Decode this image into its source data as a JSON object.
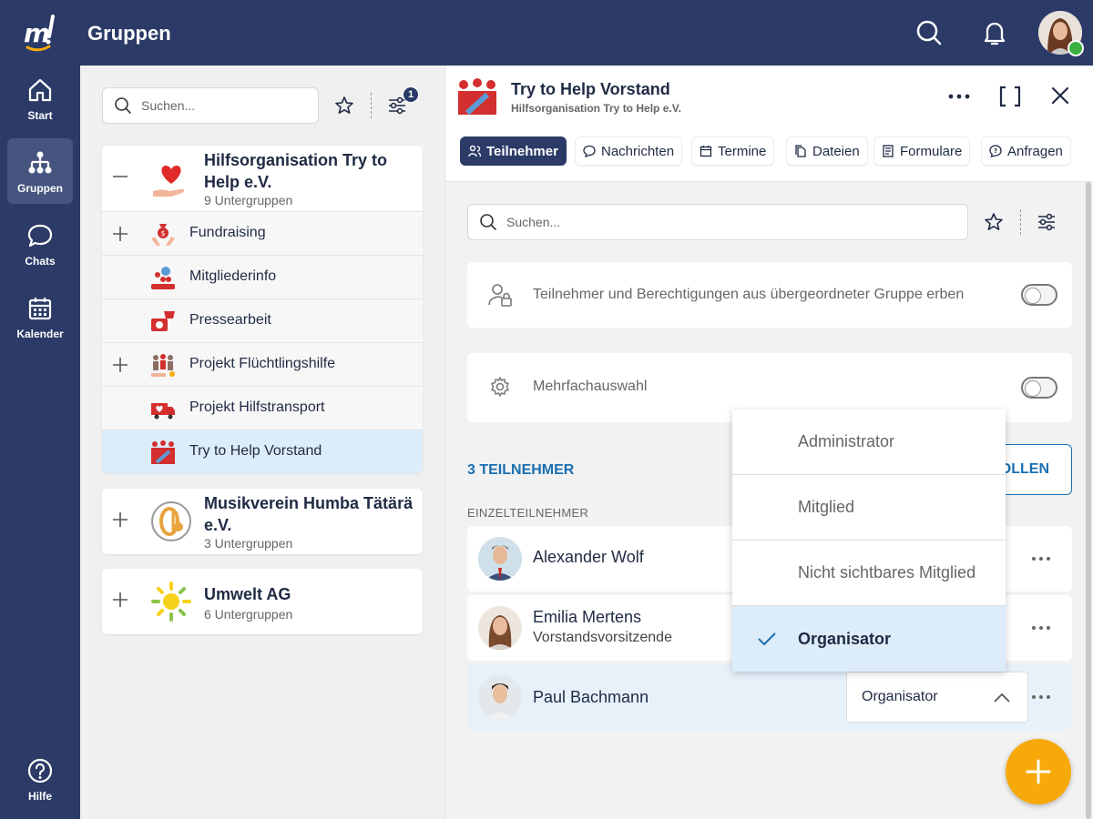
{
  "app": {
    "title": "Gruppen"
  },
  "topbar": {
    "icons": [
      "search-icon",
      "bell-icon",
      "avatar"
    ]
  },
  "sidebar": {
    "items": [
      {
        "label": "Start",
        "icon": "home-icon"
      },
      {
        "label": "Gruppen",
        "icon": "hierarchy-icon",
        "active": true
      },
      {
        "label": "Chats",
        "icon": "chat-bubble-icon"
      },
      {
        "label": "Kalender",
        "icon": "calendar-icon"
      },
      {
        "label": "Hilfe",
        "icon": "help-icon"
      }
    ]
  },
  "groups": {
    "search_placeholder": "Suchen...",
    "filter_badge": "1",
    "cards": [
      {
        "title": "Hilfsorganisation Try to Help e.V.",
        "subtitle": "9 Untergruppen",
        "expanded": true,
        "subgroups": [
          {
            "label": "Fundraising",
            "has_children": true
          },
          {
            "label": "Mitgliederinfo",
            "has_children": false
          },
          {
            "label": "Pressearbeit",
            "has_children": false
          },
          {
            "label": "Projekt Flüchtlingshilfe",
            "has_children": true
          },
          {
            "label": "Projekt Hilfstransport",
            "has_children": false
          },
          {
            "label": "Try to Help Vorstand",
            "has_children": false,
            "selected": true
          }
        ]
      },
      {
        "title": "Musikverein Humba Tätärä e.V.",
        "subtitle": "3 Untergruppen",
        "expanded": false
      },
      {
        "title": "Umwelt AG",
        "subtitle": "6 Untergruppen",
        "expanded": false
      }
    ]
  },
  "detail": {
    "title": "Try to Help Vorstand",
    "subtitle": "Hilfsorganisation Try to Help e.V.",
    "tabs": [
      {
        "label": "Teilnehmer",
        "active": true,
        "icon": "people-icon"
      },
      {
        "label": "Nachrichten",
        "icon": "message-icon"
      },
      {
        "label": "Termine",
        "icon": "calendar-icon"
      },
      {
        "label": "Dateien",
        "icon": "files-icon"
      },
      {
        "label": "Formulare",
        "icon": "form-icon"
      },
      {
        "label": "Anfragen",
        "icon": "question-bubble-icon"
      }
    ],
    "search_placeholder": "Suchen...",
    "inherit_label": "Teilnehmer und Berechtigungen aus übergeordneter Gruppe erben",
    "inherit_on": false,
    "multi_label": "Mehrfachauswahl",
    "multi_on": false,
    "count_label": "3 TEILNEHMER",
    "action_button": "OLLEN",
    "section_label": "EINZELTEILNEHMER",
    "members": [
      {
        "name": "Alexander Wolf",
        "role": ""
      },
      {
        "name": "Emilia Mertens",
        "role": "Vorstandsvorsitzende"
      },
      {
        "name": "Paul Bachmann",
        "role": "",
        "role_select": "Organisator"
      }
    ]
  },
  "dropdown": {
    "options": [
      {
        "label": "Administrator",
        "selected": false
      },
      {
        "label": "Mitglied",
        "selected": false
      },
      {
        "label": "Nicht sichtbares Mitglied",
        "selected": false
      },
      {
        "label": "Organisator",
        "selected": true
      }
    ]
  },
  "colors": {
    "navy": "#2b3a67",
    "accent_blue": "#1b6fb0",
    "fab": "#f7a90a",
    "selected_bg": "#dcecf9"
  }
}
